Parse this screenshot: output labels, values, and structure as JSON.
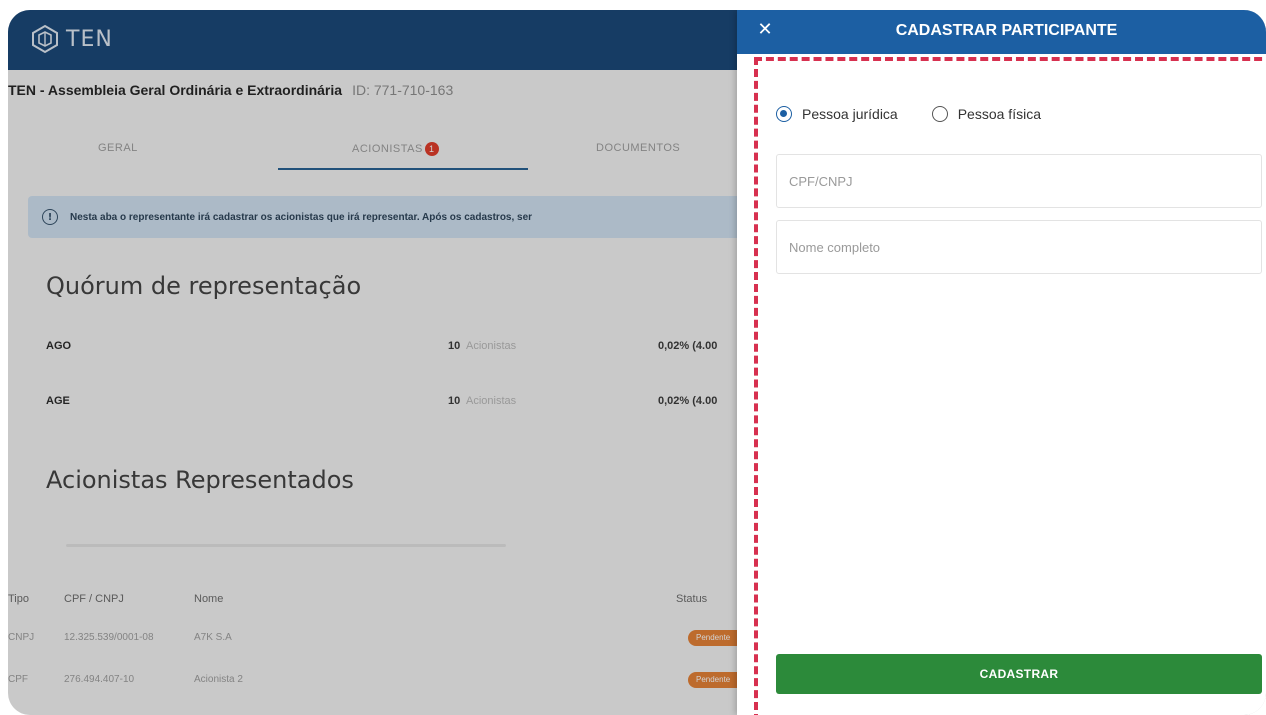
{
  "app": {
    "logo_text": "TEN"
  },
  "event": {
    "title": "TEN - Assembleia Geral Ordinária e Extraordinária",
    "id": "ID: 771-710-163"
  },
  "tabs": [
    {
      "label": "GERAL"
    },
    {
      "label": "ACIONISTAS",
      "badge": "1"
    },
    {
      "label": "DOCUMENTOS"
    }
  ],
  "info_banner": {
    "icon": "info-icon",
    "text": "Nesta aba o representante irá cadastrar os acionistas que irá representar. Após os cadastros, ser"
  },
  "quorum": {
    "title": "Quórum de representação",
    "rows": [
      {
        "label": "AGO",
        "count": "10",
        "unit": "Acionistas",
        "pct": "0,02% (4.00"
      },
      {
        "label": "AGE",
        "count": "10",
        "unit": "Acionistas",
        "pct": "0,02% (4.00"
      }
    ]
  },
  "represented": {
    "title": "Acionistas Representados",
    "columns": [
      "Tipo",
      "CPF / CNPJ",
      "Nome",
      "Status"
    ],
    "rows": [
      {
        "tipo": "CNPJ",
        "doc": "12.325.539/0001-08",
        "nome": "A7K S.A",
        "status": "Pendente"
      },
      {
        "tipo": "CPF",
        "doc": "276.494.407-10",
        "nome": "Acionista 2",
        "status": "Pendente"
      }
    ]
  },
  "drawer": {
    "title": "CADASTRAR PARTICIPANTE",
    "close_icon": "close-icon",
    "radio_options": [
      {
        "label": "Pessoa jurídica",
        "checked": true
      },
      {
        "label": "Pessoa física",
        "checked": false
      }
    ],
    "fields": {
      "doc_placeholder": "CPF/CNPJ",
      "doc_value": "",
      "name_placeholder": "Nome completo",
      "name_value": ""
    },
    "submit_label": "CADASTRAR"
  },
  "colors": {
    "header_bg": "#0f3f73",
    "drawer_header": "#1c5fa3",
    "submit_green": "#2c8a3a",
    "highlight_dash": "#d7304f",
    "status_orange": "#e57b2c"
  }
}
